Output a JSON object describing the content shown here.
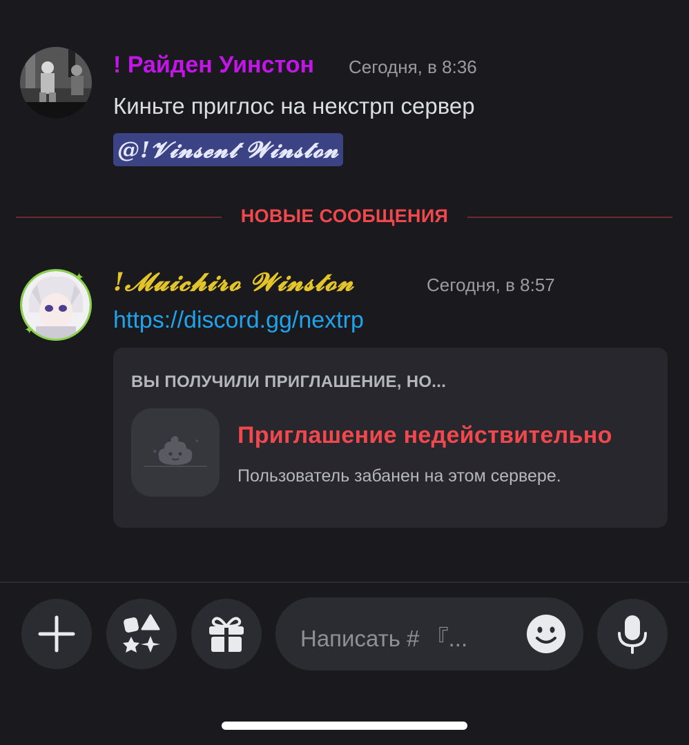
{
  "messages": [
    {
      "author": "! Райден Уинстон",
      "author_color": "#c215e8",
      "timestamp": "Сегодня, в 8:36",
      "text": "Киньте приглос на некстрп сервер",
      "mention": "@!𝓥𝓲𝓷𝓼𝓮𝓷𝓽 𝓦𝓲𝓷𝓼𝓽𝓸𝓷"
    },
    {
      "author": "!𝓜𝓾𝓲𝓬𝓱𝓲𝓻𝓸 𝓦𝓲𝓷𝓼𝓽𝓸𝓷",
      "author_color": "#e3c42a",
      "timestamp": "Сегодня, в 8:57",
      "link": "https://discord.gg/nextrp",
      "embed": {
        "title": "ВЫ ПОЛУЧИЛИ ПРИГЛАШЕНИЕ, НО...",
        "heading": "Приглашение недействительно",
        "subtitle": "Пользователь забанен на этом сервере.",
        "icon": "poop-icon"
      }
    }
  ],
  "divider": {
    "label": "НОВЫЕ СООБЩЕНИЯ",
    "color": "#f0484d"
  },
  "composer": {
    "placeholder": "Написать # 『...",
    "buttons": [
      "plus-icon",
      "apps-icon",
      "gift-icon",
      "emoji-icon",
      "microphone-icon"
    ]
  },
  "colors": {
    "background": "#1a1a1e",
    "link": "#1fa4ec",
    "mention_bg": "#3c4385",
    "embed_bg": "#27272d",
    "button_bg": "#2b2c31"
  }
}
